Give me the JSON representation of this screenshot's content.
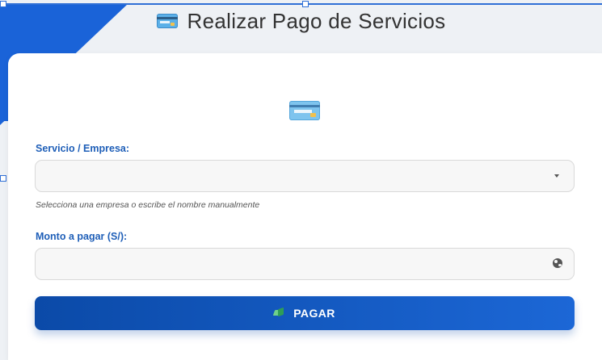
{
  "header": {
    "title": "Realizar Pago de Servicios",
    "icon": "credit-card-icon"
  },
  "form": {
    "hero_icon": "credit-card-icon",
    "service": {
      "label": "Servicio / Empresa:",
      "value": "",
      "help": "Selecciona una empresa o escribe el nombre manualmente"
    },
    "amount": {
      "label": "Monto a pagar (S/):",
      "value": "",
      "icon": "globe-icon"
    },
    "submit": {
      "label": "PAGAR",
      "icon": "money-icon"
    }
  },
  "colors": {
    "accent": "#1a63d8",
    "label": "#1f5fb8",
    "button_start": "#0b4aa8",
    "button_end": "#1c67d6"
  }
}
